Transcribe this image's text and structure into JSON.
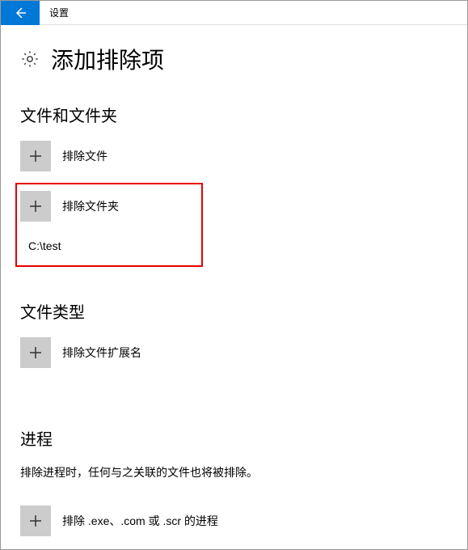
{
  "titlebar": {
    "title": "设置"
  },
  "page": {
    "title": "添加排除项"
  },
  "sections": {
    "files": {
      "title": "文件和文件夹",
      "add_file_label": "排除文件",
      "add_folder_label": "排除文件夹",
      "folder_items": [
        "C:\\test"
      ]
    },
    "types": {
      "title": "文件类型",
      "add_ext_label": "排除文件扩展名"
    },
    "processes": {
      "title": "进程",
      "description": "排除进程时，任何与之关联的文件也将被排除。",
      "add_proc_label": "排除 .exe、.com 或 .scr 的进程"
    }
  }
}
